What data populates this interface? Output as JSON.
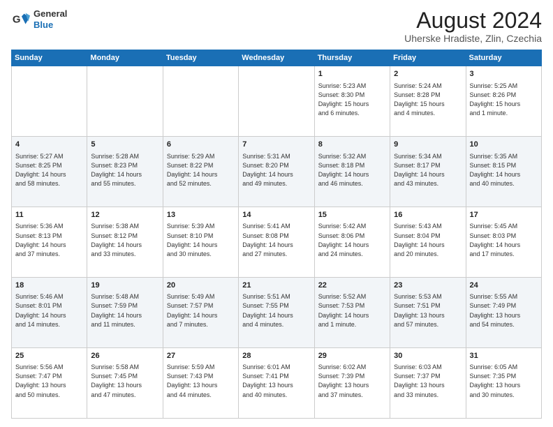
{
  "logo": {
    "line1": "General",
    "line2": "Blue"
  },
  "title": "August 2024",
  "subtitle": "Uherske Hradiste, Zlin, Czechia",
  "weekdays": [
    "Sunday",
    "Monday",
    "Tuesday",
    "Wednesday",
    "Thursday",
    "Friday",
    "Saturday"
  ],
  "weeks": [
    [
      {
        "day": "",
        "info": ""
      },
      {
        "day": "",
        "info": ""
      },
      {
        "day": "",
        "info": ""
      },
      {
        "day": "",
        "info": ""
      },
      {
        "day": "1",
        "info": "Sunrise: 5:23 AM\nSunset: 8:30 PM\nDaylight: 15 hours\nand 6 minutes."
      },
      {
        "day": "2",
        "info": "Sunrise: 5:24 AM\nSunset: 8:28 PM\nDaylight: 15 hours\nand 4 minutes."
      },
      {
        "day": "3",
        "info": "Sunrise: 5:25 AM\nSunset: 8:26 PM\nDaylight: 15 hours\nand 1 minute."
      }
    ],
    [
      {
        "day": "4",
        "info": "Sunrise: 5:27 AM\nSunset: 8:25 PM\nDaylight: 14 hours\nand 58 minutes."
      },
      {
        "day": "5",
        "info": "Sunrise: 5:28 AM\nSunset: 8:23 PM\nDaylight: 14 hours\nand 55 minutes."
      },
      {
        "day": "6",
        "info": "Sunrise: 5:29 AM\nSunset: 8:22 PM\nDaylight: 14 hours\nand 52 minutes."
      },
      {
        "day": "7",
        "info": "Sunrise: 5:31 AM\nSunset: 8:20 PM\nDaylight: 14 hours\nand 49 minutes."
      },
      {
        "day": "8",
        "info": "Sunrise: 5:32 AM\nSunset: 8:18 PM\nDaylight: 14 hours\nand 46 minutes."
      },
      {
        "day": "9",
        "info": "Sunrise: 5:34 AM\nSunset: 8:17 PM\nDaylight: 14 hours\nand 43 minutes."
      },
      {
        "day": "10",
        "info": "Sunrise: 5:35 AM\nSunset: 8:15 PM\nDaylight: 14 hours\nand 40 minutes."
      }
    ],
    [
      {
        "day": "11",
        "info": "Sunrise: 5:36 AM\nSunset: 8:13 PM\nDaylight: 14 hours\nand 37 minutes."
      },
      {
        "day": "12",
        "info": "Sunrise: 5:38 AM\nSunset: 8:12 PM\nDaylight: 14 hours\nand 33 minutes."
      },
      {
        "day": "13",
        "info": "Sunrise: 5:39 AM\nSunset: 8:10 PM\nDaylight: 14 hours\nand 30 minutes."
      },
      {
        "day": "14",
        "info": "Sunrise: 5:41 AM\nSunset: 8:08 PM\nDaylight: 14 hours\nand 27 minutes."
      },
      {
        "day": "15",
        "info": "Sunrise: 5:42 AM\nSunset: 8:06 PM\nDaylight: 14 hours\nand 24 minutes."
      },
      {
        "day": "16",
        "info": "Sunrise: 5:43 AM\nSunset: 8:04 PM\nDaylight: 14 hours\nand 20 minutes."
      },
      {
        "day": "17",
        "info": "Sunrise: 5:45 AM\nSunset: 8:03 PM\nDaylight: 14 hours\nand 17 minutes."
      }
    ],
    [
      {
        "day": "18",
        "info": "Sunrise: 5:46 AM\nSunset: 8:01 PM\nDaylight: 14 hours\nand 14 minutes."
      },
      {
        "day": "19",
        "info": "Sunrise: 5:48 AM\nSunset: 7:59 PM\nDaylight: 14 hours\nand 11 minutes."
      },
      {
        "day": "20",
        "info": "Sunrise: 5:49 AM\nSunset: 7:57 PM\nDaylight: 14 hours\nand 7 minutes."
      },
      {
        "day": "21",
        "info": "Sunrise: 5:51 AM\nSunset: 7:55 PM\nDaylight: 14 hours\nand 4 minutes."
      },
      {
        "day": "22",
        "info": "Sunrise: 5:52 AM\nSunset: 7:53 PM\nDaylight: 14 hours\nand 1 minute."
      },
      {
        "day": "23",
        "info": "Sunrise: 5:53 AM\nSunset: 7:51 PM\nDaylight: 13 hours\nand 57 minutes."
      },
      {
        "day": "24",
        "info": "Sunrise: 5:55 AM\nSunset: 7:49 PM\nDaylight: 13 hours\nand 54 minutes."
      }
    ],
    [
      {
        "day": "25",
        "info": "Sunrise: 5:56 AM\nSunset: 7:47 PM\nDaylight: 13 hours\nand 50 minutes."
      },
      {
        "day": "26",
        "info": "Sunrise: 5:58 AM\nSunset: 7:45 PM\nDaylight: 13 hours\nand 47 minutes."
      },
      {
        "day": "27",
        "info": "Sunrise: 5:59 AM\nSunset: 7:43 PM\nDaylight: 13 hours\nand 44 minutes."
      },
      {
        "day": "28",
        "info": "Sunrise: 6:01 AM\nSunset: 7:41 PM\nDaylight: 13 hours\nand 40 minutes."
      },
      {
        "day": "29",
        "info": "Sunrise: 6:02 AM\nSunset: 7:39 PM\nDaylight: 13 hours\nand 37 minutes."
      },
      {
        "day": "30",
        "info": "Sunrise: 6:03 AM\nSunset: 7:37 PM\nDaylight: 13 hours\nand 33 minutes."
      },
      {
        "day": "31",
        "info": "Sunrise: 6:05 AM\nSunset: 7:35 PM\nDaylight: 13 hours\nand 30 minutes."
      }
    ]
  ]
}
